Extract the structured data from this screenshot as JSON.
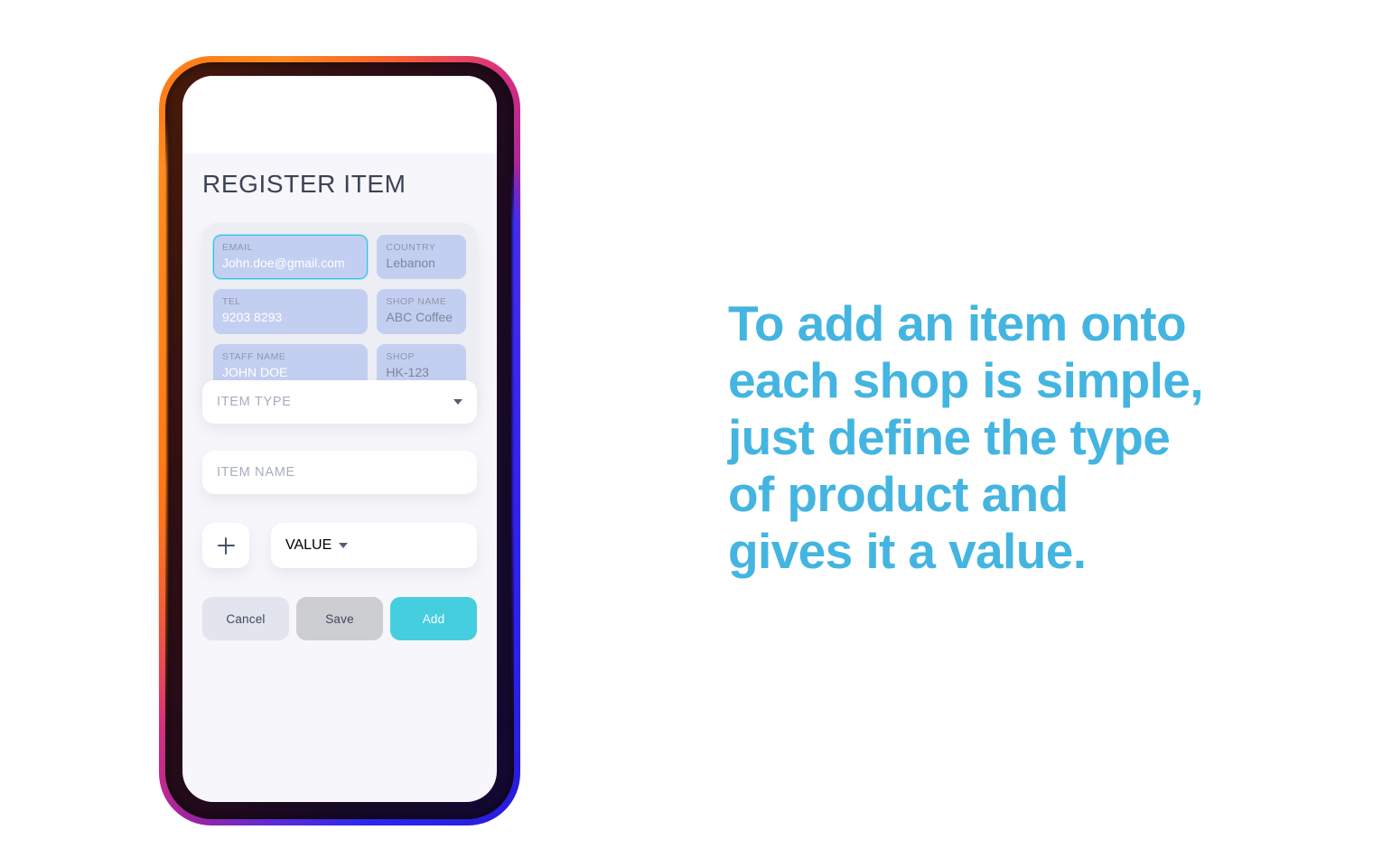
{
  "phone": {
    "screen_title": "REGISTER ITEM",
    "info_fields": [
      {
        "label": "EMAIL",
        "value": "John.doe@gmail.com",
        "column": "left",
        "focused": true
      },
      {
        "label": "COUNTRY",
        "value": "Lebanon",
        "column": "right",
        "focused": false
      },
      {
        "label": "TEL",
        "value": "9203 8293",
        "column": "left",
        "focused": false
      },
      {
        "label": "SHOP NAME",
        "value": "ABC Coffee",
        "column": "right",
        "focused": false
      },
      {
        "label": "STAFF NAME",
        "value": "JOHN DOE",
        "column": "left",
        "focused": false
      },
      {
        "label": "SHOP",
        "value": "HK-123",
        "column": "right",
        "focused": false
      }
    ],
    "item_type_placeholder": "ITEM TYPE",
    "item_name_placeholder": "ITEM NAME",
    "value_placeholder": "VALUE",
    "add_item_button_label": "+",
    "buttons": {
      "cancel": "Cancel",
      "save": "Save",
      "add": "Add"
    }
  },
  "headline": {
    "line1": "To add an item onto",
    "line2": "each shop is simple,",
    "line3": "just define the type",
    "line4": "of product and",
    "line5": "gives it a value."
  },
  "colors": {
    "accent_cyan": "#45cfde",
    "headline_blue": "#44b5e0",
    "field_fill": "#c3cff1",
    "card_bg": "#eceef3",
    "title_text": "#3b4456",
    "screen_bg": "#f7f6fa"
  }
}
